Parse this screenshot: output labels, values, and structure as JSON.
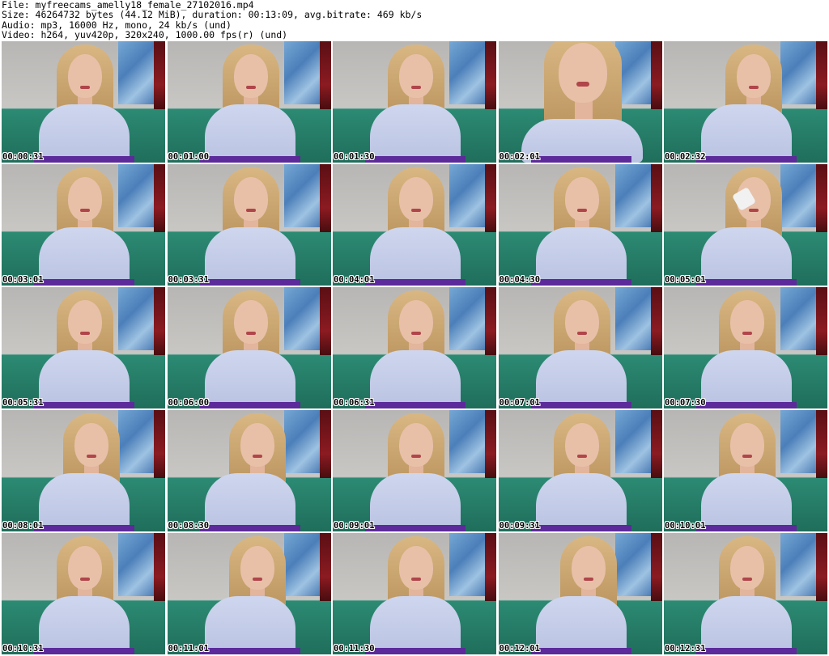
{
  "header": {
    "line1": "File: myfreecams_amelly18_female_27102016.mp4",
    "line2": "Size: 46264732 bytes (44.12 MiB), duration: 00:13:09, avg.bitrate: 469 kb/s",
    "line3": "Audio: mp3, 16000 Hz, mono, 24 kb/s (und)",
    "line4": "Video: h264, yuv420p, 320x240, 1000.00 fps(r) (und)"
  },
  "thumbnails": [
    {
      "timestamp": "00:00:31"
    },
    {
      "timestamp": "00:01:00"
    },
    {
      "timestamp": "00:01:30"
    },
    {
      "timestamp": "00:02:01"
    },
    {
      "timestamp": "00:02:32"
    },
    {
      "timestamp": "00:03:01"
    },
    {
      "timestamp": "00:03:31"
    },
    {
      "timestamp": "00:04:01"
    },
    {
      "timestamp": "00:04:30"
    },
    {
      "timestamp": "00:05:01"
    },
    {
      "timestamp": "00:05:31"
    },
    {
      "timestamp": "00:06:00"
    },
    {
      "timestamp": "00:06:31"
    },
    {
      "timestamp": "00:07:01"
    },
    {
      "timestamp": "00:07:30"
    },
    {
      "timestamp": "00:08:01"
    },
    {
      "timestamp": "00:08:30"
    },
    {
      "timestamp": "00:09:01"
    },
    {
      "timestamp": "00:09:31"
    },
    {
      "timestamp": "00:10:01"
    },
    {
      "timestamp": "00:10:31"
    },
    {
      "timestamp": "00:11:01"
    },
    {
      "timestamp": "00:11:30"
    },
    {
      "timestamp": "00:12:01"
    },
    {
      "timestamp": "00:12:31"
    }
  ]
}
